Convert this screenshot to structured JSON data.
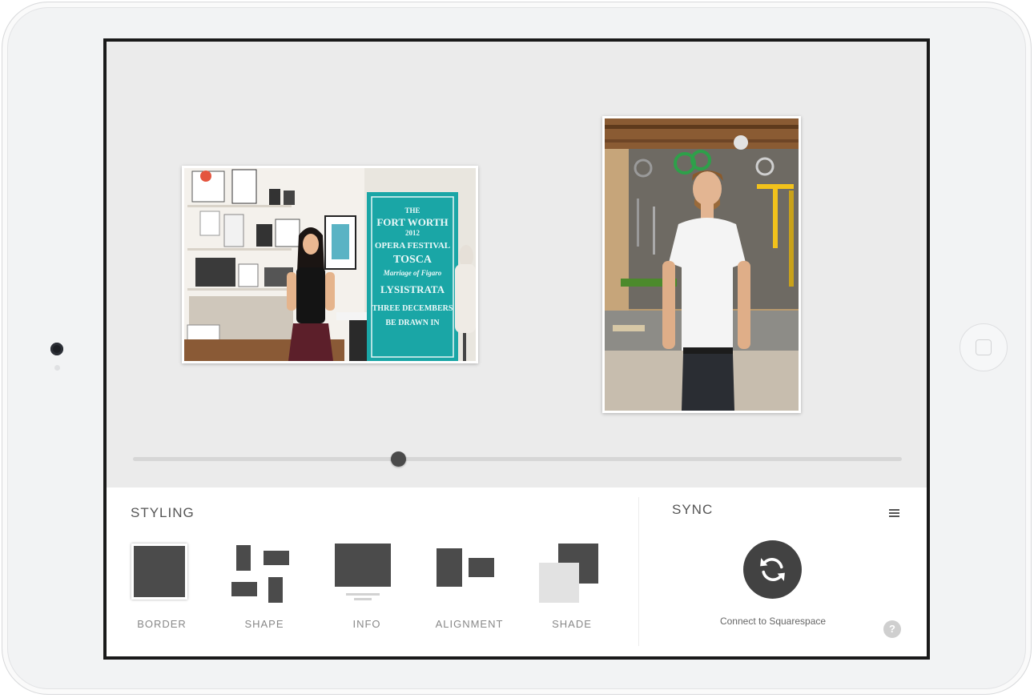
{
  "slider": {
    "position": 0.345
  },
  "styling": {
    "title": "STYLING",
    "tools": [
      {
        "label": "BORDER",
        "selected": true
      },
      {
        "label": "SHAPE"
      },
      {
        "label": "INFO"
      },
      {
        "label": "ALIGNMENT"
      },
      {
        "label": "SHADE"
      }
    ]
  },
  "sync": {
    "title": "SYNC",
    "connect_label": "Connect to Squarespace",
    "help_label": "?"
  },
  "photos": [
    {
      "poster_lines": [
        "THE",
        "FORT WORTH",
        "2012",
        "OPERA FESTIVAL",
        "TOSCA",
        "Marriage of Figaro",
        "LYSISTRATA",
        "THREE DECEMBERS",
        "BE DRAWN IN"
      ]
    }
  ],
  "colors": {
    "accent": "#4b4b4b",
    "canvas_bg": "#ebebeb",
    "poster": "#1aa6a6"
  }
}
